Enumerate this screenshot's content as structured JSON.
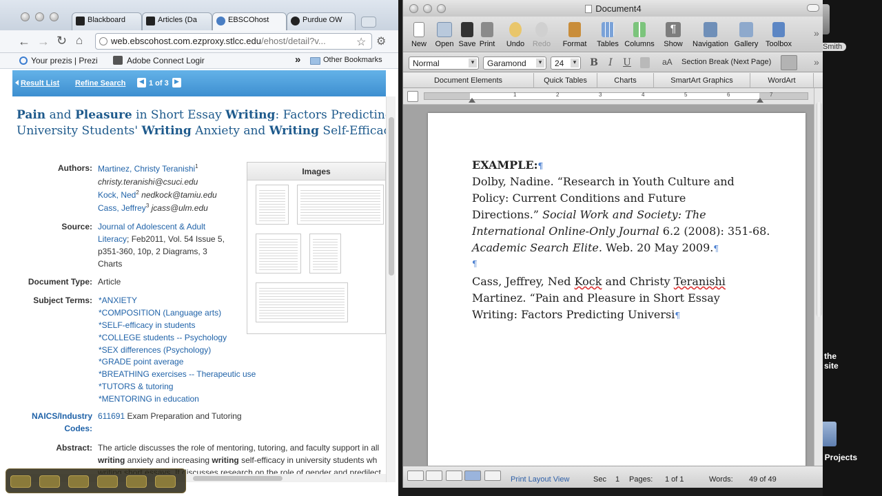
{
  "desktop": {
    "fragments": [
      "Smith",
      "the",
      "site",
      "d Projects"
    ]
  },
  "browser": {
    "tabs": [
      {
        "label": "Blackboard"
      },
      {
        "label": "Articles (Da"
      },
      {
        "label": "EBSCOhost"
      },
      {
        "label": "Purdue OW"
      }
    ],
    "url_main": "web.ebscohost.com.ezproxy.stlcc.edu",
    "url_rest": "/ehost/detail?v...",
    "bookmarks": [
      "Your prezis | Prezi",
      "Adobe Connect Logir",
      "»",
      "Other Bookmarks"
    ],
    "ebsco": {
      "result_list": "Result List",
      "refine_search": "Refine Search",
      "pager": "1 of 3"
    },
    "article": {
      "title_line1": [
        "Pain",
        " and ",
        "Pleasure",
        " in Short Essay ",
        "Writing",
        ": Factors Predicting"
      ],
      "title_line2": [
        "University Students' ",
        "Writing",
        " Anxiety and ",
        "Writing",
        " Self-Efficacy"
      ],
      "authors_label": "Authors:",
      "author1": "Martinez, Christy Teranishi",
      "author1_sup": "1",
      "author1_email": "christy.teranishi@csuci.edu",
      "author2": "Kock, Ned",
      "author2_sup": "2",
      "author2_email": "nedkock@tamiu.edu",
      "author3": "Cass, Jeffrey",
      "author3_sup": "3",
      "author3_email": "jcass@ulm.edu",
      "source_label": "Source:",
      "source_journal_1": "Journal of Adolescent & Adult",
      "source_journal_2": "Literacy",
      "source_rest_1": "; Feb2011, Vol. 54 Issue 5,",
      "source_rest_2": "p351-360, 10p, 2 Diagrams, 3",
      "source_rest_3": "Charts",
      "doctype_label": "Document Type:",
      "doctype": "Article",
      "subject_label": "Subject Terms:",
      "subjects": [
        "*ANXIETY",
        "*COMPOSITION (Language arts)",
        "*SELF-efficacy in students",
        "*COLLEGE students -- Psychology",
        "*SEX differences (Psychology)",
        "*GRADE point average",
        "*BREATHING exercises -- Therapeutic use",
        "*TUTORS & tutoring",
        "*MENTORING in education"
      ],
      "naics_label_1": "NAICS/Industry",
      "naics_label_2": "Codes:",
      "naics_code": "611691",
      "naics_text": "Exam Preparation and Tutoring",
      "abstract_label": "Abstract:",
      "abstract_1": "The article discusses the role of mentoring, tutoring, and faculty support in all",
      "abstract_2a": "writing",
      "abstract_2b": " anxiety and increasing ",
      "abstract_2c": "writing",
      "abstract_2d": " self-efficacy in university students wh",
      "abstract_3": "writing short essays. It discusses research on the role of gender and predilect"
    },
    "images_title": "Images"
  },
  "word": {
    "title": "Document4",
    "toolbar": [
      "New",
      "Open",
      "Save",
      "Print",
      "Undo",
      "Redo",
      "Format",
      "Tables",
      "Columns",
      "Show",
      "Navigation",
      "Gallery",
      "Toolbox"
    ],
    "style": "Normal",
    "font": "Garamond",
    "size": "24",
    "bold": "B",
    "italic": "I",
    "underline": "U",
    "section_break": "Section Break (Next Page)",
    "ribbon": [
      "Document Elements",
      "Quick Tables",
      "Charts",
      "SmartArt Graphics",
      "WordArt"
    ],
    "ruler_nums": [
      "1",
      "2",
      "3",
      "4",
      "5",
      "6",
      "7"
    ],
    "doc": {
      "heading": "EXAMPLE:",
      "l1": "Dolby, Nadine. “Research in Youth Culture and",
      "l2": "Policy: Current Conditions and Future",
      "l3": "Directions.” ",
      "l3i": "Social Work and Society: The",
      "l4i": "International Online-Only Journal",
      "l4": " 6.2 (2008): 351-68.",
      "l5i": "Academic Search Elite.",
      "l5": "  Web.  20 May 2009.",
      "l6a": "Cass, Jeffrey, Ned ",
      "l6b": "Kock",
      "l6c": " and Christy ",
      "l6d": "Teranishi",
      "l7": "Martinez.  “Pain and Pleasure in Short Essay",
      "l8": "Writing: Factors Predicting Universi",
      "pilcrow": "¶"
    },
    "status": {
      "view": "Print Layout View",
      "sec_label": "Sec",
      "sec": "1",
      "pages_label": "Pages:",
      "pages": "1 of 1",
      "words_label": "Words:",
      "words": "49 of 49"
    }
  }
}
